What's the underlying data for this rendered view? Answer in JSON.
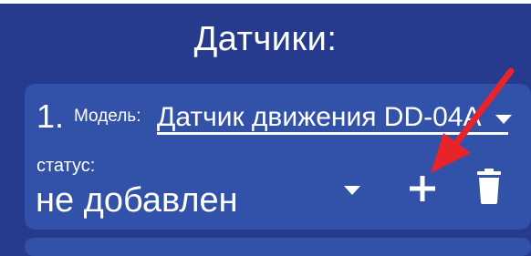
{
  "header": {
    "title": "Датчики:"
  },
  "sensor_card": {
    "index": "1.",
    "model_label": "Модель:",
    "model_value": "Датчик движения DD-04А",
    "status_label": "статус:",
    "status_value": "не добавлен"
  },
  "icons": {
    "dropdown": "triangle-down",
    "add": "plus-icon",
    "delete": "trash-icon",
    "annotation": "red-arrow"
  },
  "colors": {
    "background": "#263a8e",
    "card": "#3251a8",
    "text": "#ffffff",
    "annotation_arrow": "#e8232a"
  }
}
